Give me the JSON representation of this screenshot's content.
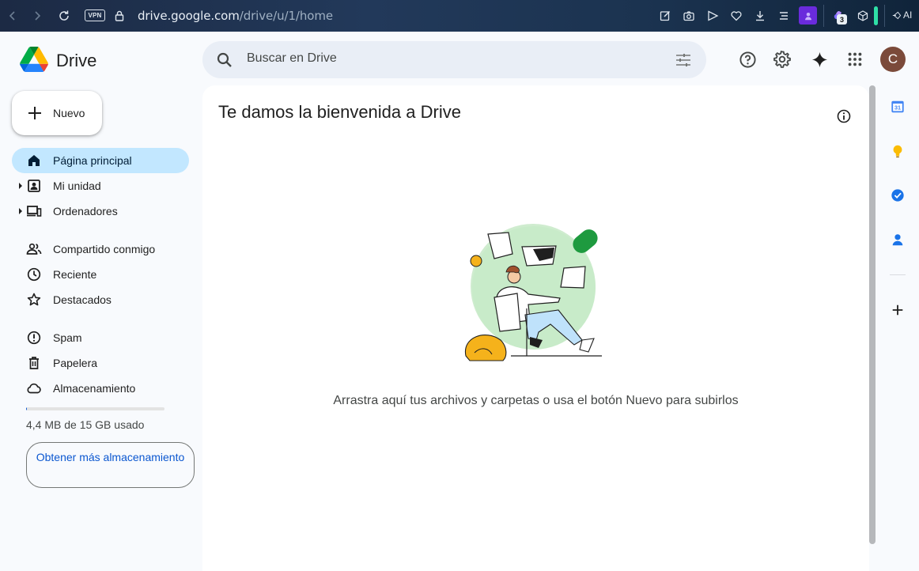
{
  "browser": {
    "url_host": "drive.google.com",
    "url_path": "/drive/u/1/home",
    "vpn_label": "VPN",
    "ext_count": "3",
    "ai_label": "AI"
  },
  "header": {
    "app_name": "Drive",
    "search_placeholder": "Buscar en Drive",
    "avatar_letter": "C"
  },
  "sidebar": {
    "new_label": "Nuevo",
    "items": [
      {
        "label": "Página principal"
      },
      {
        "label": "Mi unidad"
      },
      {
        "label": "Ordenadores"
      },
      {
        "label": "Compartido conmigo"
      },
      {
        "label": "Reciente"
      },
      {
        "label": "Destacados"
      },
      {
        "label": "Spam"
      },
      {
        "label": "Papelera"
      },
      {
        "label": "Almacenamiento"
      }
    ],
    "storage_used_fraction": 0.0003,
    "storage_text": "4,4 MB de 15 GB usado",
    "get_more_storage": "Obtener más almacenamiento"
  },
  "main": {
    "title": "Te damos la bienvenida a Drive",
    "empty_message": "Arrastra aquí tus archivos y carpetas o usa el botón Nuevo para subirlos"
  },
  "side_panel": {
    "calendar_day": "31"
  },
  "colors": {
    "active_nav": "#c2e7ff",
    "link_blue": "#0b57d0",
    "search_bg": "#e9eef6",
    "page_bg": "#f8fafd"
  }
}
